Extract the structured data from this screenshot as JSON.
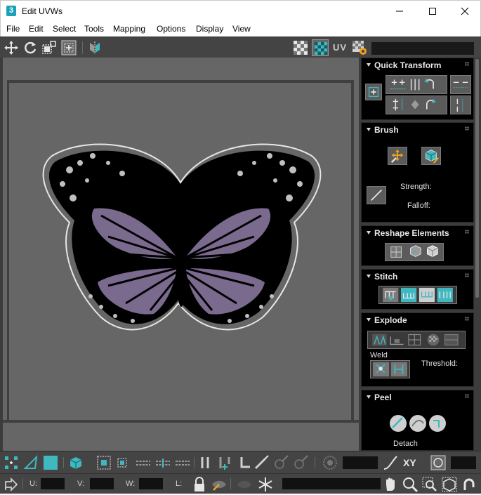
{
  "window": {
    "app_icon_text": "3",
    "title": "Edit UVWs"
  },
  "menu": {
    "items": [
      "File",
      "Edit",
      "Select",
      "Tools",
      "Mapping",
      "Options",
      "Display",
      "View"
    ]
  },
  "toolbar": {
    "uv_label": "UV",
    "texture_dropdown_value": ""
  },
  "rollouts": {
    "quick_transform": {
      "title": "Quick Transform"
    },
    "brush": {
      "title": "Brush",
      "strength_label": "Strength:",
      "falloff_label": "Falloff:"
    },
    "reshape": {
      "title": "Reshape Elements"
    },
    "stitch": {
      "title": "Stitch"
    },
    "explode": {
      "title": "Explode",
      "weld_label": "Weld",
      "threshold_label": "Threshold:"
    },
    "peel": {
      "title": "Peel",
      "detach_label": "Detach"
    }
  },
  "bottom": {
    "xy_label": "XY",
    "u_label": "U:",
    "v_label": "V:",
    "w_label": "W:",
    "l_label": "L:",
    "u_value": "",
    "v_value": "",
    "w_value": "",
    "l_value": ""
  },
  "colors": {
    "accent_teal": "#3fb8c0",
    "panel_bg": "#000000",
    "viewport_bg": "#666666",
    "wing_purple": "#7a6a8e",
    "selection_orange": "#f0a020"
  }
}
